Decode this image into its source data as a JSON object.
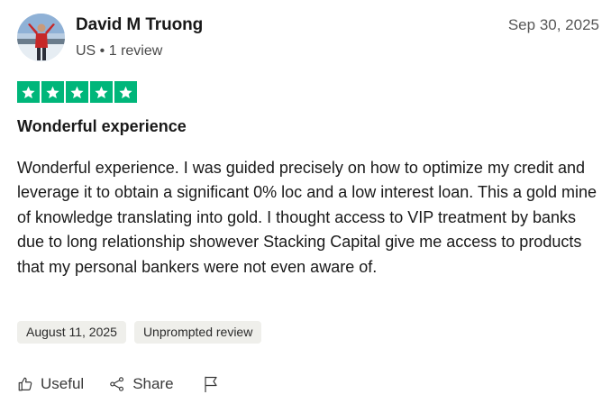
{
  "reviewer": {
    "name": "David M Truong",
    "meta": "US • 1 review",
    "avatar_icon": "user-photo"
  },
  "review": {
    "date": "Sep 30, 2025",
    "rating": 5,
    "rating_max": 5,
    "title": "Wonderful experience",
    "body": "Wonderful experience. I was guided precisely on how to optimize my credit and leverage it to obtain a significant 0% loc and a low interest loan. This a gold mine of knowledge translating into gold. I thought access to VIP treatment by banks due to long relationship showever Stacking Capital give me access to products that my personal bankers were not even aware of.",
    "tags": [
      "August 11, 2025",
      "Unprompted review"
    ]
  },
  "actions": {
    "useful_label": "Useful",
    "share_label": "Share",
    "useful_icon": "thumbs-up-icon",
    "share_icon": "share-icon",
    "flag_icon": "flag-icon"
  },
  "colors": {
    "star_green": "#00b67a",
    "tag_bg": "#efefeb",
    "text": "#191919",
    "muted": "#575757"
  }
}
